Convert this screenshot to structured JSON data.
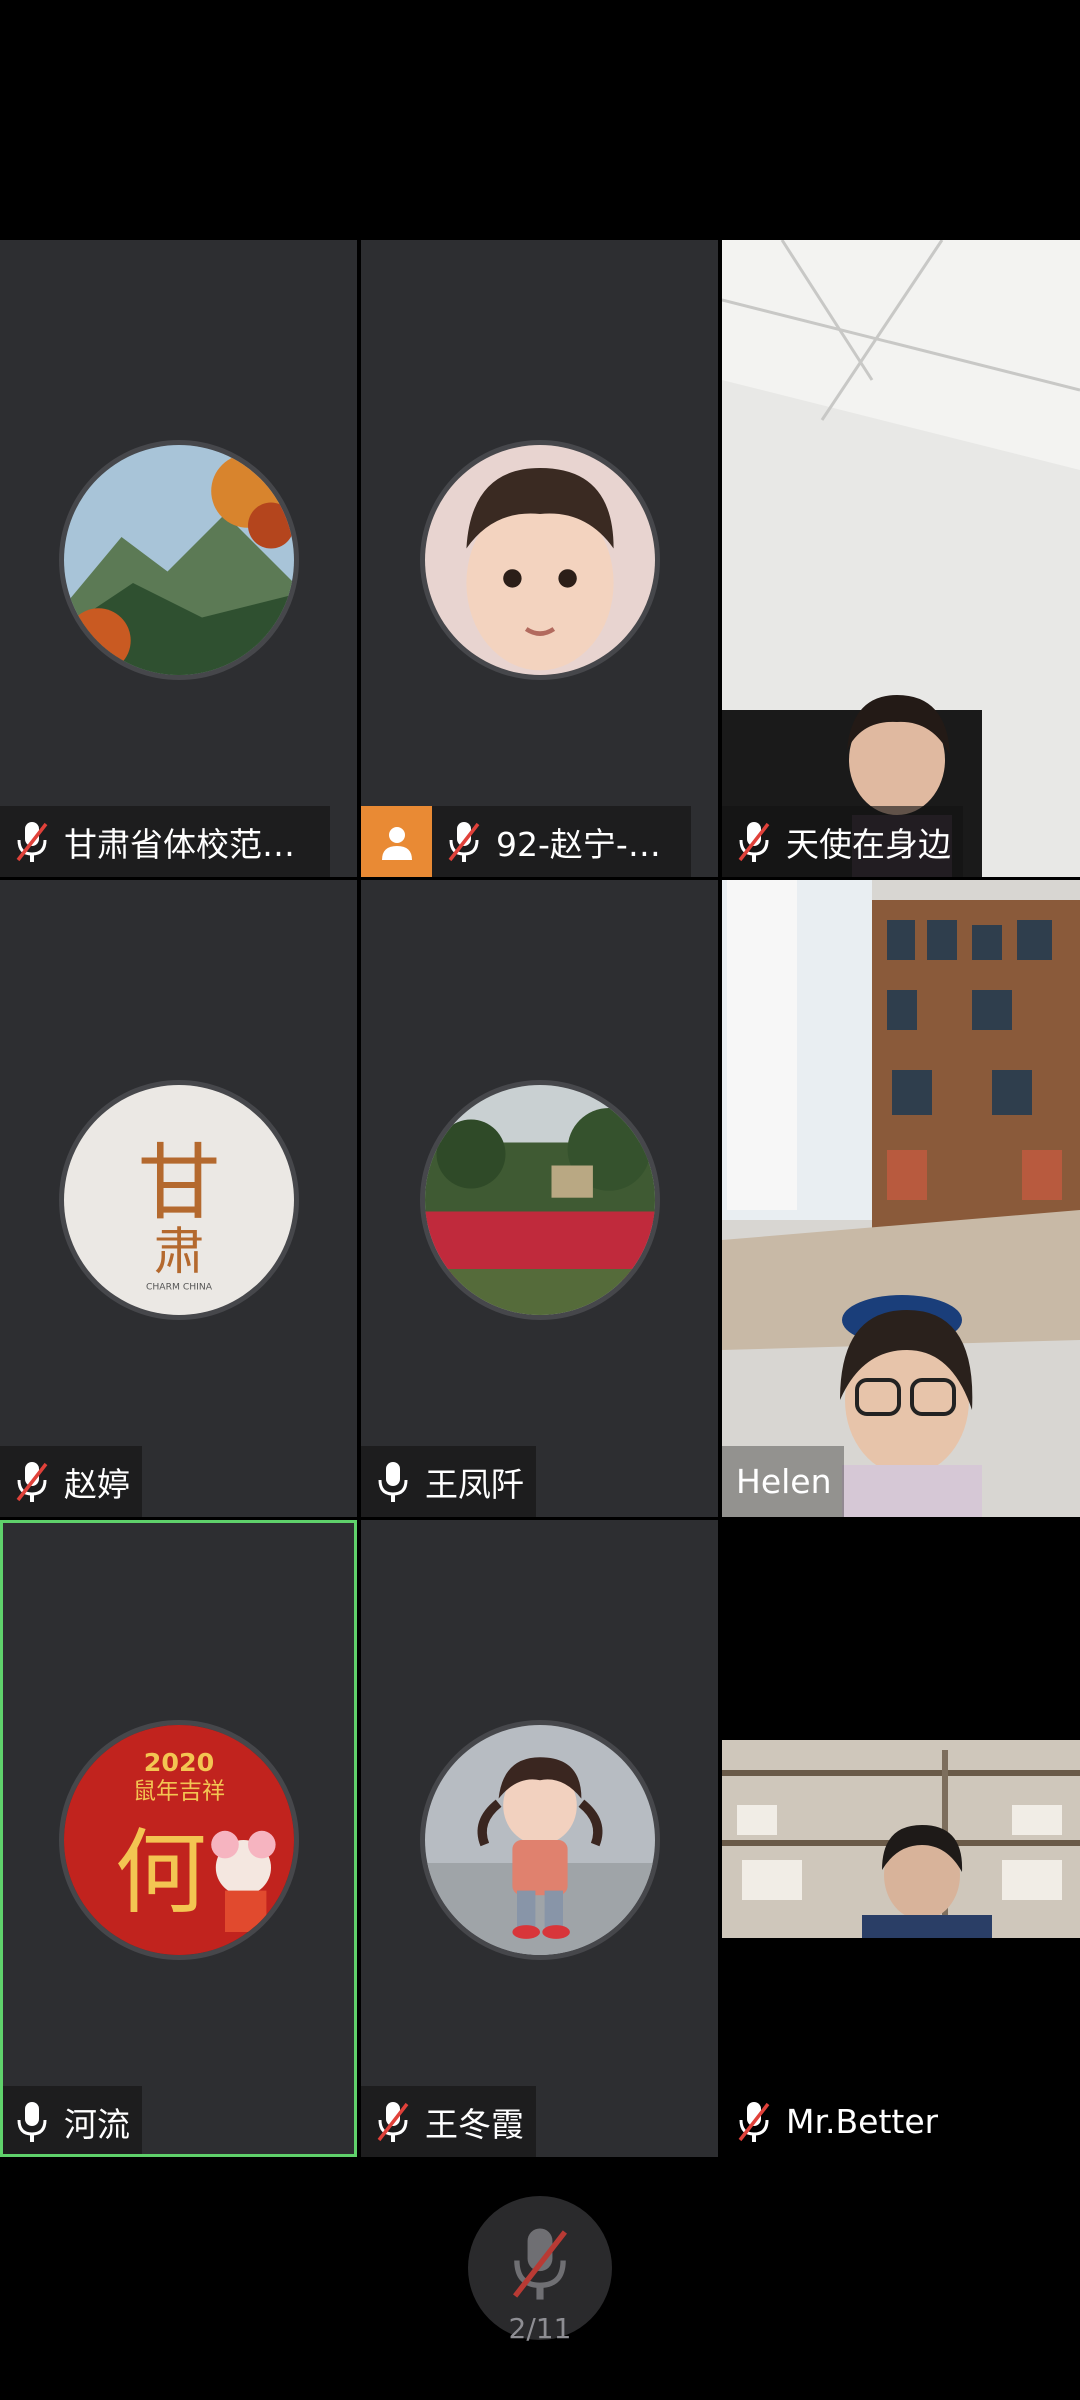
{
  "participants": [
    {
      "name": "甘肃省体校范剑...",
      "muted": true,
      "type": "avatar",
      "avatar": "autumn-landscape"
    },
    {
      "name": "92-赵宁-省...",
      "muted": true,
      "type": "avatar",
      "avatar": "child-photo",
      "host": true
    },
    {
      "name": "天使在身边",
      "muted": true,
      "type": "video"
    },
    {
      "name": "赵婷",
      "muted": true,
      "type": "avatar",
      "avatar": "gansu-logo",
      "logo_text": "CHARM CHINA"
    },
    {
      "name": "王凤阡",
      "muted": false,
      "type": "avatar",
      "avatar": "flower-garden"
    },
    {
      "name": "Helen",
      "muted": null,
      "type": "video"
    },
    {
      "name": "河流",
      "muted": false,
      "type": "avatar",
      "avatar": "new-year-2020",
      "active_speaker": true
    },
    {
      "name": "王冬霞",
      "muted": true,
      "type": "avatar",
      "avatar": "doll-girl"
    },
    {
      "name": "Mr.Better",
      "muted": true,
      "type": "video"
    }
  ],
  "footer": {
    "page_indicator": "2/11",
    "mic_icon": "mic-muted-icon"
  },
  "colors": {
    "tile_bg": "#2d2e31",
    "active_border": "#5fd16b",
    "muted_slash": "#e0413a",
    "host_badge": "#e98a34"
  }
}
